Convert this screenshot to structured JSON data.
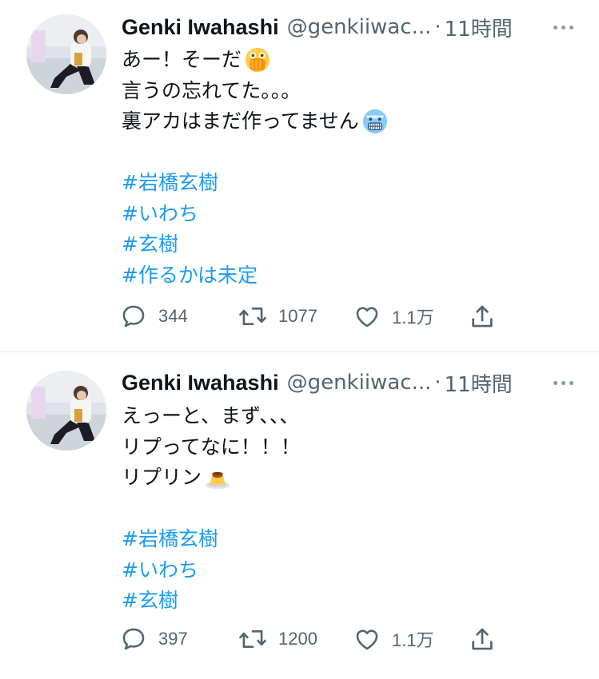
{
  "tweets": [
    {
      "name": "Genki Iwahashi",
      "handle": "@genkiiwac...",
      "sep": "·",
      "time": "11時間",
      "lines": [
        "あー！そーだ",
        "言うの忘れてた。。。",
        "裏アカはまだ作ってません"
      ],
      "emojis": [
        "face-with-open-eyes-and-hand-over-mouth-emoji",
        "cold-face-emoji"
      ],
      "hashtags": [
        "#岩橋玄樹",
        "#いわち",
        "#玄樹",
        "#作るかは未定"
      ],
      "replies": "344",
      "retweets": "1077",
      "likes": "1.1万"
    },
    {
      "name": "Genki Iwahashi",
      "handle": "@genkiiwac...",
      "sep": "·",
      "time": "11時間",
      "lines": [
        "えっーと、まず、、、",
        "リプってなに！！！",
        "リプリン"
      ],
      "emojis": [
        "custard-pudding-emoji"
      ],
      "hashtags": [
        "#岩橋玄樹",
        "#いわち",
        "#玄樹"
      ],
      "replies": "397",
      "retweets": "1200",
      "likes": "1.1万"
    }
  ],
  "colors": {
    "hashtag": "#1d9bf0",
    "secondary": "#536471",
    "divider": "#e6e9ec"
  },
  "icons": [
    "reply-icon",
    "retweet-icon",
    "like-icon",
    "share-icon",
    "more-icon"
  ]
}
